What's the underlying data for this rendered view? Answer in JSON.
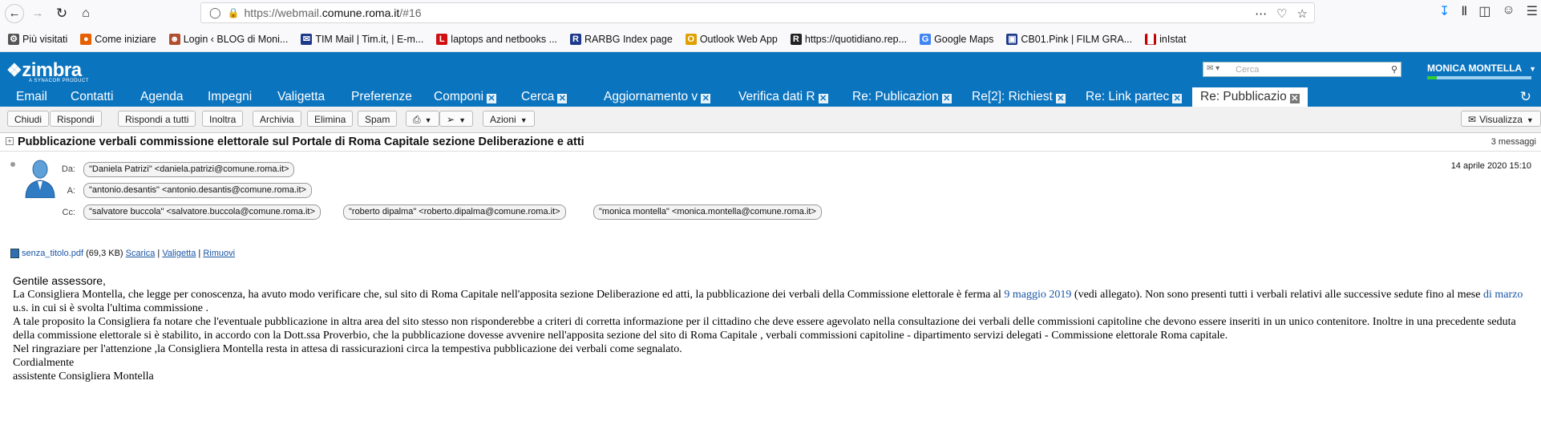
{
  "browser": {
    "url_prefix": "https://webmail.",
    "url_domain": "comune.roma.it",
    "url_suffix": "/#16",
    "bookmarks": [
      {
        "label": "Più visitati",
        "icon": "gear-icon",
        "color": "#555555"
      },
      {
        "label": "Come iniziare",
        "icon": "firefox-icon",
        "color": "#e66000"
      },
      {
        "label": "Login ‹ BLOG di Moni...",
        "icon": "blog-icon",
        "color": "#b05030"
      },
      {
        "label": "TIM Mail | Tim.it, | E-m...",
        "icon": "mail-icon",
        "color": "#1e3a8a"
      },
      {
        "label": "laptops and netbooks ...",
        "icon": "l-icon",
        "color": "#d01010"
      },
      {
        "label": "RARBG Index page",
        "icon": "r-icon",
        "color": "#1e3a8a"
      },
      {
        "label": "Outlook Web App",
        "icon": "outlook-icon",
        "color": "#e0a000"
      },
      {
        "label": "https://quotidiano.rep...",
        "icon": "repubblica-icon",
        "color": "#222222"
      },
      {
        "label": "Google Maps",
        "icon": "google-icon",
        "color": "#4285f4"
      },
      {
        "label": "CB01.Pink | FILM GRA...",
        "icon": "film-icon",
        "color": "#1e3a8a"
      },
      {
        "label": "inIstat",
        "icon": "istat-icon",
        "color": "#c00000"
      }
    ]
  },
  "zimbra": {
    "logo": "zimbra",
    "logo_sub": "A SYNACOR PRODUCT",
    "search_placeholder": "Cerca",
    "user": "MONICA MONTELLA",
    "tabs": [
      {
        "label": "Email",
        "close": false
      },
      {
        "label": "Contatti",
        "close": false
      },
      {
        "label": "Agenda",
        "close": false
      },
      {
        "label": "Impegni",
        "close": false
      },
      {
        "label": "Valigetta",
        "close": false
      },
      {
        "label": "Preferenze",
        "close": false
      },
      {
        "label": "Componi",
        "close": true
      },
      {
        "label": "Cerca",
        "close": true
      },
      {
        "label": "Aggiornamento v",
        "close": true
      },
      {
        "label": "Verifica dati R",
        "close": true
      },
      {
        "label": "Re: Publicazion",
        "close": true
      },
      {
        "label": "Re[2]: Richiest",
        "close": true
      },
      {
        "label": "Re: Link partec",
        "close": true
      },
      {
        "label": "Re: Pubblicazio",
        "close": true,
        "active": true
      }
    ],
    "toolbar": {
      "chiudi": "Chiudi",
      "rispondi": "Rispondi",
      "rispondi_tutti": "Rispondi a tutti",
      "inoltra": "Inoltra",
      "archivia": "Archivia",
      "elimina": "Elimina",
      "spam": "Spam",
      "azioni": "Azioni",
      "visualizza": "Visualizza"
    }
  },
  "message": {
    "subject": "Pubblicazione verbali commissione elettorale sul Portale di Roma Capitale sezione Deliberazione e atti",
    "count": "3 messaggi",
    "from_label": "Da:",
    "to_label": "A:",
    "cc_label": "Cc:",
    "from": "\"Daniela Patrizi\" <daniela.patrizi@comune.roma.it>",
    "to": "\"antonio.desantis\" <antonio.desantis@comune.roma.it>",
    "cc": [
      "\"salvatore buccola\" <salvatore.buccola@comune.roma.it>",
      "\"roberto dipalma\" <roberto.dipalma@comune.roma.it>",
      "\"monica montella\" <monica.montella@comune.roma.it>"
    ],
    "date": "14 aprile 2020 15:10",
    "attachment": {
      "filename": "senza_titolo.pdf",
      "size": "(69,3 KB)",
      "scarica": "Scarica",
      "valigetta": "Valigetta",
      "rimuovi": "Rimuovi"
    },
    "body": {
      "greeting": "Gentile assessore,",
      "p1_a": "La Consigliera Montella, che legge per conoscenza, ha avuto modo verificare che, sul sito di Roma Capitale nell'apposita sezione Deliberazione ed atti, la pubblicazione dei verbali della Commissione elettorale è ferma al ",
      "p1_link1": "9 maggio 2019",
      "p1_b": " (vedi allegato). Non sono presenti tutti i verbali relativi alle successive sedute fino al mese ",
      "p1_link2": "di marzo",
      "p1_c": " u.s. in cui si è svolta l'ultima commissione .",
      "p2": "A tale proposito la Consigliera fa  notare che l'eventuale pubblicazione in altra area del sito stesso non risponderebbe a criteri di corretta informazione per il cittadino che deve essere agevolato nella consultazione dei  verbali delle commissioni capitoline che devono essere inseriti in un unico contenitore. Inoltre  in una precedente seduta della commissione elettorale si è stabilito, in accordo con la Dott.ssa Proverbio, che la pubblicazione dovesse avvenire nell'apposita sezione del sito di Roma Capitale , verbali commissioni capitoline - dipartimento servizi delegati - Commissione elettorale Roma capitale.",
      "p3": "Nel ringraziare per l'attenzione ,la Consigliera Montella resta in attesa di rassicurazioni circa la tempestiva pubblicazione dei verbali come segnalato.",
      "p4": "Cordialmente",
      "p5": "assistente Consigliera Montella"
    }
  }
}
